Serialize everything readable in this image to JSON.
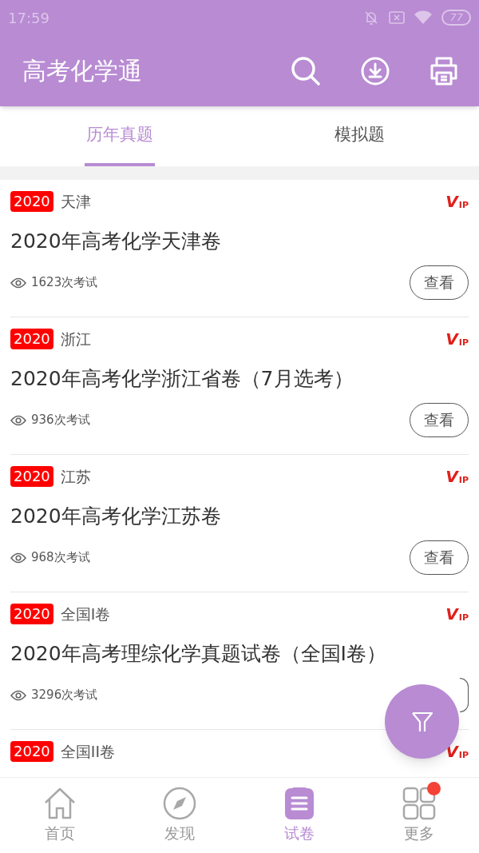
{
  "status_bar": {
    "time": "17:59",
    "battery": "77"
  },
  "header": {
    "title": "高考化学通"
  },
  "tabs": [
    {
      "label": "历年真题",
      "selected": true
    },
    {
      "label": "模拟题",
      "selected": false
    }
  ],
  "papers": [
    {
      "year": "2020",
      "region": "天津",
      "vip": "VIP",
      "title": "2020年高考化学天津卷",
      "count": "1623次考试",
      "action": "查看"
    },
    {
      "year": "2020",
      "region": "浙江",
      "vip": "VIP",
      "title": "2020年高考化学浙江省卷（7月选考）",
      "count": "936次考试",
      "action": "查看"
    },
    {
      "year": "2020",
      "region": "江苏",
      "vip": "VIP",
      "title": "2020年高考化学江苏卷",
      "count": "968次考试",
      "action": "查看"
    },
    {
      "year": "2020",
      "region": "全国I卷",
      "vip": "VIP",
      "title": "2020年高考理综化学真题试卷（全国I卷）",
      "count": "3296次考试"
    },
    {
      "year": "2020",
      "region": "全国II卷",
      "vip": "VIP"
    }
  ],
  "bottom_nav": [
    {
      "label": "首页",
      "kind": "home",
      "selected": false,
      "badge": false
    },
    {
      "label": "发现",
      "kind": "compass",
      "selected": false,
      "badge": false
    },
    {
      "label": "试卷",
      "kind": "paper",
      "selected": true,
      "badge": false
    },
    {
      "label": "更多",
      "kind": "grid",
      "selected": false,
      "badge": true
    }
  ]
}
